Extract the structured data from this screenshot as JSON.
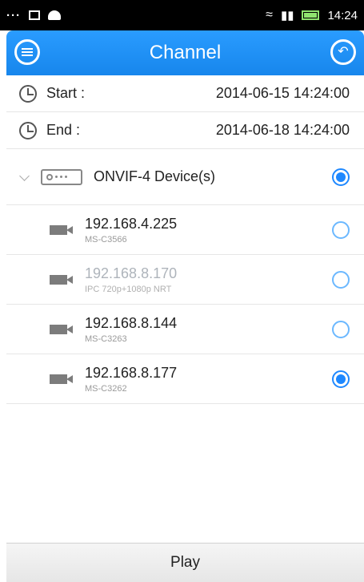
{
  "statusbar": {
    "left_icons": [
      "more-dots-icon",
      "square-icon",
      "android-icon"
    ],
    "dots": "···",
    "time": "14:24"
  },
  "appbar": {
    "title": "Channel",
    "left_icon": "menu-icon",
    "right_icon": "back-icon"
  },
  "range": {
    "start": {
      "label": "Start :",
      "value": "2014-06-15 14:24:00"
    },
    "end": {
      "label": "End :",
      "value": "2014-06-18 14:24:00"
    }
  },
  "group": {
    "label": "ONVIF-4 Device(s)",
    "checked": true
  },
  "devices": [
    {
      "ip": "192.168.4.225",
      "model": "MS-C3566",
      "checked": false,
      "enabled": true
    },
    {
      "ip": "192.168.8.170",
      "model": "IPC 720p+1080p NRT",
      "checked": false,
      "enabled": false
    },
    {
      "ip": "192.168.8.144",
      "model": "MS-C3263",
      "checked": false,
      "enabled": true
    },
    {
      "ip": "192.168.8.177",
      "model": "MS-C3262",
      "checked": true,
      "enabled": true
    }
  ],
  "play": {
    "label": "Play"
  },
  "colors": {
    "accent": "#1E88FF",
    "appbar": "#1786EC"
  }
}
